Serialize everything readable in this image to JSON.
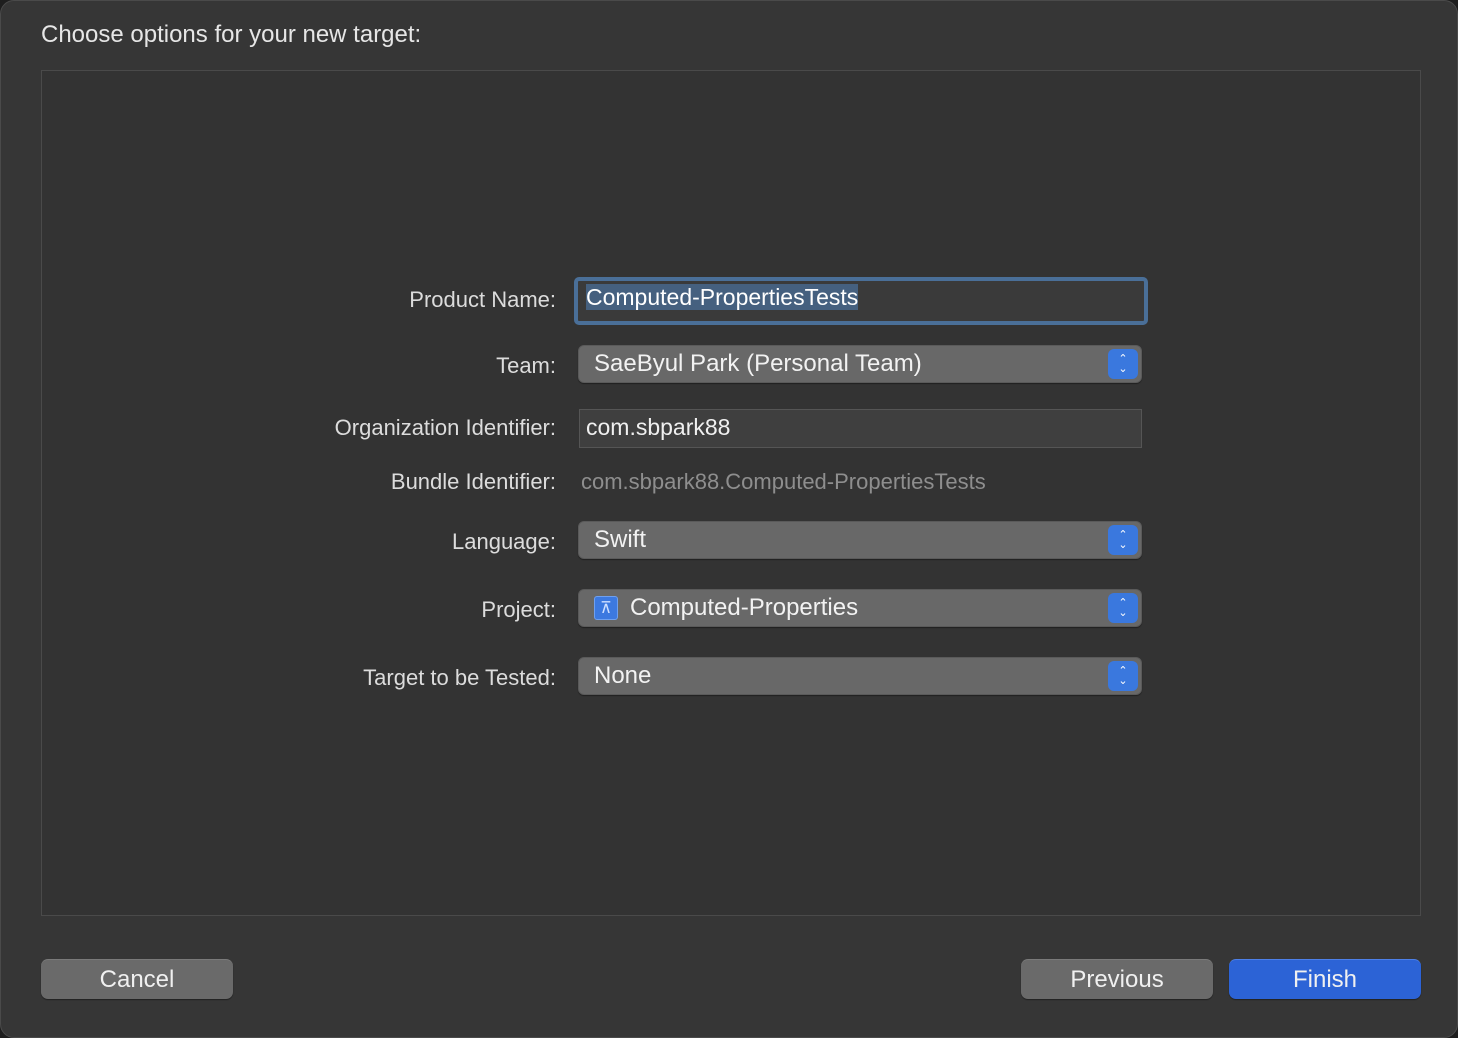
{
  "dialog": {
    "heading": "Choose options for your new target:"
  },
  "form": {
    "product_name": {
      "label": "Product Name:",
      "value": "Computed-PropertiesTests"
    },
    "team": {
      "label": "Team:",
      "value": "SaeByul Park (Personal Team)"
    },
    "organization_identifier": {
      "label": "Organization Identifier:",
      "value": "com.sbpark88"
    },
    "bundle_identifier": {
      "label": "Bundle Identifier:",
      "value": "com.sbpark88.Computed-PropertiesTests"
    },
    "language": {
      "label": "Language:",
      "value": "Swift"
    },
    "project": {
      "label": "Project:",
      "value": "Computed-Properties",
      "icon": "xcode-project-icon"
    },
    "target_to_be_tested": {
      "label": "Target to be Tested:",
      "value": "None"
    }
  },
  "buttons": {
    "cancel": "Cancel",
    "previous": "Previous",
    "finish": "Finish"
  },
  "colors": {
    "accent": "#2c63d6",
    "focus_ring": "#4a6f98",
    "background": "#363636"
  }
}
